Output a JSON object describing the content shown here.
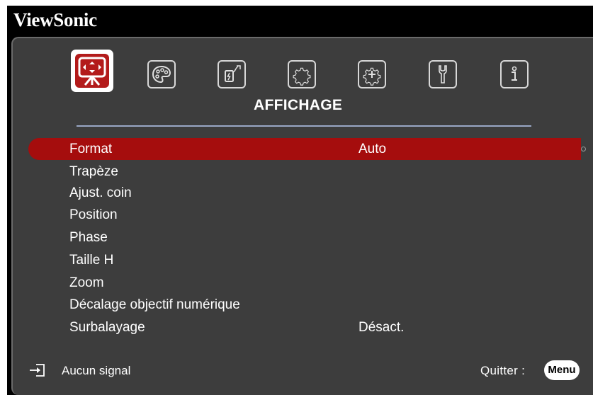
{
  "brand": "ViewSonic",
  "tabs": [
    {
      "icon": "display-icon",
      "active": true
    },
    {
      "icon": "palette-icon",
      "active": false
    },
    {
      "icon": "power-plug-icon",
      "active": false
    },
    {
      "icon": "gear-icon",
      "active": false
    },
    {
      "icon": "advanced-gear-icon",
      "active": false
    },
    {
      "icon": "wrench-icon",
      "active": false
    },
    {
      "icon": "info-icon",
      "active": false
    }
  ],
  "section_title": "AFFICHAGE",
  "menu": {
    "items": [
      {
        "label": "Format",
        "value": "Auto",
        "selected": true
      },
      {
        "label": "Trapèze",
        "value": ""
      },
      {
        "label": "Ajust. coin",
        "value": ""
      },
      {
        "label": "Position",
        "value": ""
      },
      {
        "label": "Phase",
        "value": ""
      },
      {
        "label": "Taille H",
        "value": ""
      },
      {
        "label": "Zoom",
        "value": ""
      },
      {
        "label": "Décalage objectif numérique",
        "value": ""
      },
      {
        "label": "Surbalayage",
        "value": "Désact."
      }
    ]
  },
  "footer": {
    "input_icon": "input-source-icon",
    "status": "Aucun signal",
    "quit_label": "Quitter :",
    "menu_key": "Menu"
  },
  "colors": {
    "highlight": "#a50d0d",
    "active_tab": "#b31b1b",
    "panel": "#3d3d3d",
    "rule": "#9aa7c6"
  }
}
